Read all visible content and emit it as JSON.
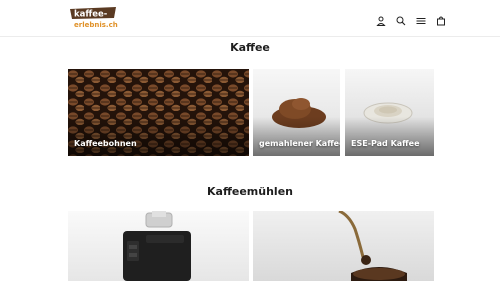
{
  "header": {
    "logo_line1": "kaffee-",
    "logo_line2": "erlebnis.ch",
    "icons": [
      "user-icon",
      "search-icon",
      "menu-icon",
      "cart-icon"
    ]
  },
  "sections": {
    "coffee_title": "Kaffee",
    "grinders_title": "Kaffeemühlen"
  },
  "tiles": {
    "beans": "Kaffeebohnen",
    "ground": "gemahlener Kaffee",
    "pads": "ESE-Pad Kaffee"
  },
  "colors": {
    "brand_brown": "#5a3a22",
    "brand_orange": "#e0922a",
    "text": "#1e1e1e"
  }
}
